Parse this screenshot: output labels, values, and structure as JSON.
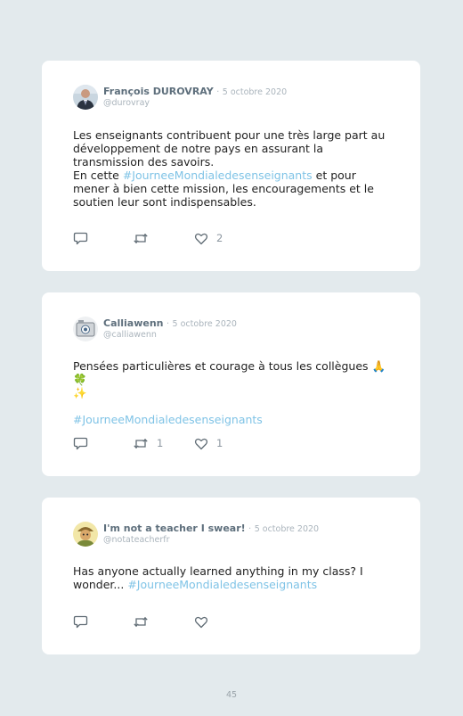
{
  "tweets": [
    {
      "author": "François DUROVRAY",
      "separator": "·",
      "date": "5 octobre 2020",
      "handle": "@durovray",
      "text_1": "Les enseignants contribuent pour une très large part au développement de notre pays en assurant la transmission des savoirs.",
      "text_2a": "En cette ",
      "hashtag": "#JourneeMondialedesenseignants",
      "text_2b": " et pour mener à bien cette mission, les encouragements et le soutien leur sont indispensables.",
      "retweets": "",
      "likes": "2"
    },
    {
      "author": "Calliawenn",
      "separator": "·",
      "date": "5 octobre 2020",
      "handle": "@calliawenn",
      "text_1": "Pensées particulières et courage à tous les collègues 🙏🍀",
      "text_2": "✨",
      "hashtag": "#JourneeMondialedesenseignants",
      "retweets": "1",
      "likes": "1"
    },
    {
      "author": "I'm not a teacher I swear!",
      "separator": "·",
      "date": "5 octobre 2020",
      "handle": "@notateacherfr",
      "text_1": "Has anyone actually learned anything in my class? I wonder... ",
      "hashtag": "#JourneeMondialedesenseignants",
      "retweets": "",
      "likes": ""
    }
  ],
  "icons": [
    "reply-icon",
    "retweet-icon",
    "heart-icon"
  ],
  "colors": {
    "background": "#e3eaed",
    "card": "#ffffff",
    "hashtag": "#7fc3e6",
    "author": "#5e6f7c",
    "meta": "#aab4bc"
  },
  "page_number": "45"
}
